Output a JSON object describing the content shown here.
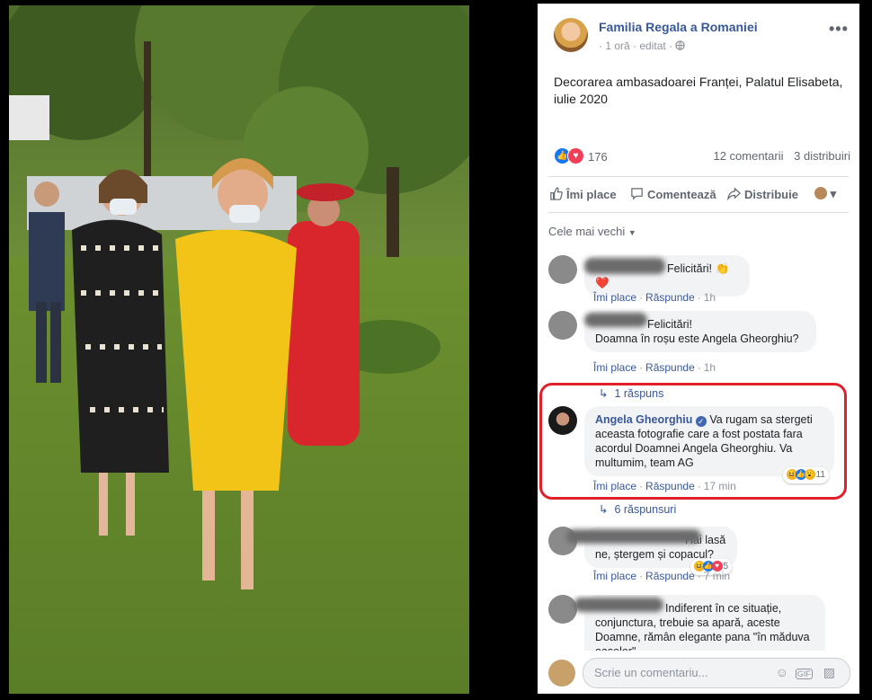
{
  "post": {
    "page_name": "Familia Regala a Romaniei",
    "time": "1 oră",
    "edited": "editat",
    "text": "Decorarea ambasadoarei Franței, Palatul Elisabeta, iulie 2020",
    "reaction_count": "176",
    "comments_count": "12 comentarii",
    "shares_count": "3 distribuiri"
  },
  "actions": {
    "like": "Îmi place",
    "comment": "Comentează",
    "share": "Distribuie"
  },
  "sort_label": "Cele mai vechi",
  "comments": [
    {
      "text": "Felicitări!",
      "like": "Îmi place",
      "reply": "Răspunde",
      "time": "1h"
    },
    {
      "text_line1": "Felicitări!",
      "text_line2": "Doamna în roșu este Angela Gheorghiu?",
      "like": "Îmi place",
      "reply": "Răspunde",
      "time": "1h",
      "replies": "1 răspuns"
    },
    {
      "author": "Angela Gheorghiu",
      "text": "Va rugam sa stergeti aceasta fotografie care a fost postata fara acordul Doamnei Angela Gheorghiu. Va multumim, team AG",
      "like": "Îmi place",
      "reply": "Răspunde",
      "time": "17 min",
      "reaction_count": "11",
      "replies": "6 răspunsuri"
    },
    {
      "text": "Hai lasă ne, ștergem și copacul?",
      "like": "Îmi place",
      "reply": "Răspunde",
      "time": "7 min",
      "reaction_count": "5"
    },
    {
      "text": "Indiferent în ce situație, conjunctura, trebuie sa apară, aceste Doamne, rămân elegante pana \"în măduva oaselor\""
    }
  ],
  "composer": {
    "placeholder": "Scrie un comentariu..."
  },
  "colors": {
    "link": "#385898",
    "highlight": "#e0212b",
    "like_blue": "#1877f2",
    "love_red": "#f33e58"
  },
  "icons": [
    "globe-icon",
    "more-icon",
    "like-icon",
    "love-icon",
    "comment-icon",
    "share-icon",
    "reply-arrow-icon",
    "emoji-icon",
    "gif-icon",
    "sticker-icon",
    "verified-icon"
  ]
}
